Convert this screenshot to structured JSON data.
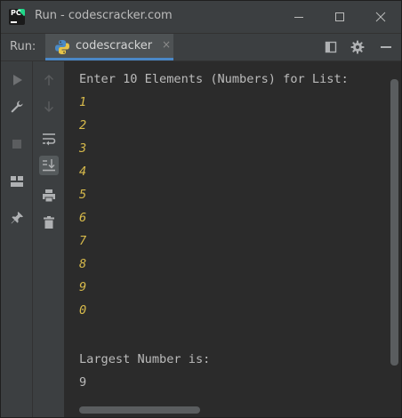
{
  "window": {
    "title": "Run - codescracker.com",
    "app_icon_text": "PC"
  },
  "run_panel": {
    "label": "Run:",
    "tab_label": "codescracker",
    "tab_close": "×"
  },
  "console": {
    "prompt": "Enter 10 Elements (Numbers) for List:",
    "inputs": [
      "1",
      "2",
      "3",
      "4",
      "5",
      "6",
      "7",
      "8",
      "9",
      "0"
    ],
    "result_label": "Largest Number is:",
    "result_value": "9"
  },
  "colors": {
    "background": "#2b2b2b",
    "panel": "#3c3f41",
    "text": "#bbbbbb",
    "user_input": "#d7ba4b",
    "tab_underline": "#4a88c7"
  },
  "icons": {
    "left_strip": [
      "rerun-icon",
      "wrench-icon",
      "stop-icon",
      "layout-icon",
      "pin-icon"
    ],
    "left_strip2": [
      "up-arrow-icon",
      "down-arrow-icon",
      "soft-wrap-icon",
      "scroll-to-end-icon",
      "print-icon",
      "trash-icon"
    ],
    "header_right": [
      "restore-layout-icon",
      "gear-icon",
      "minimize-panel-icon"
    ]
  }
}
